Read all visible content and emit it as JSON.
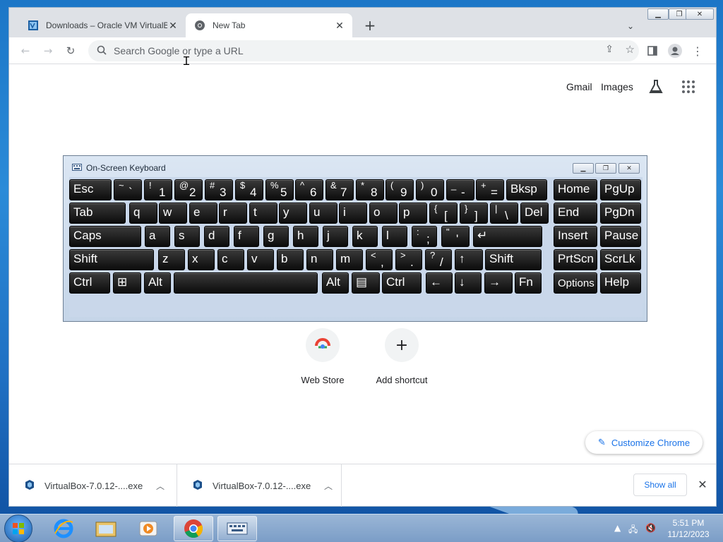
{
  "browser": {
    "tabs": [
      {
        "title": "Downloads – Oracle VM VirtualBox",
        "active": false
      },
      {
        "title": "New Tab",
        "active": true
      }
    ],
    "new_tab_button": "+",
    "tab_search_icon": "chevron-down-icon",
    "window_buttons": [
      "minimize",
      "restore",
      "close"
    ],
    "omnibox": {
      "placeholder": "Search Google or type a URL",
      "value": ""
    }
  },
  "ntp": {
    "links": [
      "Gmail",
      "Images"
    ],
    "shortcuts": [
      {
        "label": "Web Store",
        "icon": "webstore-icon"
      },
      {
        "label": "Add shortcut",
        "icon": "plus-icon",
        "glyph": "+"
      }
    ],
    "customize_label": "Customize Chrome"
  },
  "osk": {
    "title": "On-Screen Keyboard",
    "rows": [
      [
        {
          "label": "Esc"
        },
        {
          "sup": "~",
          "main": "`"
        },
        {
          "sup": "!",
          "main": "1"
        },
        {
          "sup": "@",
          "main": "2"
        },
        {
          "sup": "#",
          "main": "3"
        },
        {
          "sup": "$",
          "main": "4"
        },
        {
          "sup": "%",
          "main": "5"
        },
        {
          "sup": "^",
          "main": "6"
        },
        {
          "sup": "&",
          "main": "7"
        },
        {
          "sup": "*",
          "main": "8"
        },
        {
          "sup": "(",
          "main": "9"
        },
        {
          "sup": ")",
          "main": "0"
        },
        {
          "sup": "_",
          "main": "-"
        },
        {
          "sup": "+",
          "main": "="
        },
        {
          "label": "Bksp"
        },
        {
          "label": "Home"
        },
        {
          "label": "PgUp"
        }
      ],
      [
        {
          "label": "Tab"
        },
        {
          "label": "q"
        },
        {
          "label": "w"
        },
        {
          "label": "e"
        },
        {
          "label": "r"
        },
        {
          "label": "t"
        },
        {
          "label": "y"
        },
        {
          "label": "u"
        },
        {
          "label": "i"
        },
        {
          "label": "o"
        },
        {
          "label": "p"
        },
        {
          "sup": "{",
          "main": "["
        },
        {
          "sup": "}",
          "main": "]"
        },
        {
          "sup": "|",
          "main": "\\"
        },
        {
          "label": "Del"
        },
        {
          "label": "End"
        },
        {
          "label": "PgDn"
        }
      ],
      [
        {
          "label": "Caps"
        },
        {
          "label": "a"
        },
        {
          "label": "s"
        },
        {
          "label": "d"
        },
        {
          "label": "f"
        },
        {
          "label": "g"
        },
        {
          "label": "h"
        },
        {
          "label": "j"
        },
        {
          "label": "k"
        },
        {
          "label": "l"
        },
        {
          "sup": ":",
          "main": ";"
        },
        {
          "sup": "\"",
          "main": "'"
        },
        {
          "label": "↵"
        },
        {
          "label": "Insert"
        },
        {
          "label": "Pause"
        }
      ],
      [
        {
          "label": "Shift"
        },
        {
          "label": "z"
        },
        {
          "label": "x"
        },
        {
          "label": "c"
        },
        {
          "label": "v"
        },
        {
          "label": "b"
        },
        {
          "label": "n"
        },
        {
          "label": "m"
        },
        {
          "sup": "<",
          "main": ","
        },
        {
          "sup": ">",
          "main": "."
        },
        {
          "sup": "?",
          "main": "/"
        },
        {
          "label": "↑"
        },
        {
          "label": "Shift"
        },
        {
          "label": "PrtScn"
        },
        {
          "label": "ScrLk"
        }
      ],
      [
        {
          "label": "Ctrl"
        },
        {
          "label": "⊞"
        },
        {
          "label": "Alt"
        },
        {
          "label": ""
        },
        {
          "label": "Alt"
        },
        {
          "label": "▤"
        },
        {
          "label": "Ctrl"
        },
        {
          "label": "←"
        },
        {
          "label": "↓"
        },
        {
          "label": "→"
        },
        {
          "label": "Fn"
        },
        {
          "label": "Options"
        },
        {
          "label": "Help"
        }
      ]
    ]
  },
  "downloads": {
    "items": [
      {
        "filename": "VirtualBox-7.0.12-....exe"
      },
      {
        "filename": "VirtualBox-7.0.12-....exe"
      }
    ],
    "show_all_label": "Show all"
  },
  "taskbar": {
    "apps": [
      "internet-explorer-icon",
      "windows-explorer-icon",
      "media-player-icon",
      "chrome-icon",
      "on-screen-keyboard-icon"
    ],
    "time": "5:51 PM",
    "date": "11/12/2023"
  },
  "colors": {
    "accent": "#1a73e8",
    "tabstrip": "#dee1e6",
    "osk_bg": "#c9d7ea"
  }
}
